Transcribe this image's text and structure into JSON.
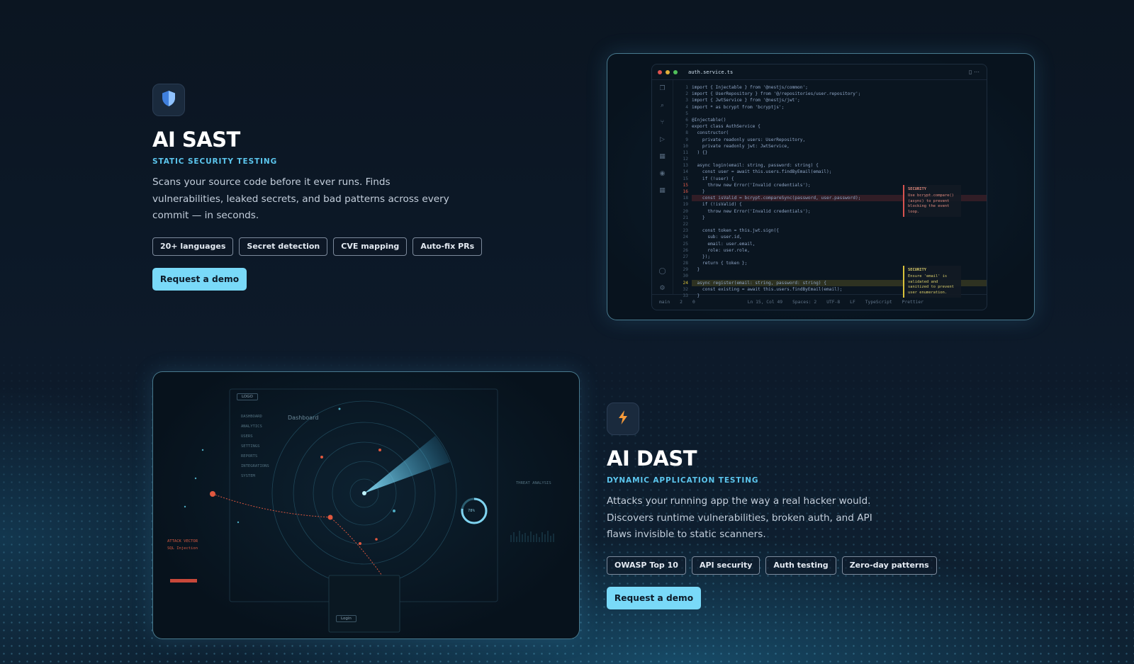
{
  "sast": {
    "icon": "shield-icon",
    "title": "AI SAST",
    "subtitle": "STATIC SECURITY TESTING",
    "description": "Scans your source code before it ever runs. Finds vulnerabilities, leaked secrets, and bad patterns across every commit — in seconds.",
    "tags": [
      "20+ languages",
      "Secret detection",
      "CVE mapping",
      "Auto-fix PRs"
    ],
    "cta": "Request a demo",
    "editor": {
      "filename": "auth.service.ts",
      "lines": [
        "import { Injectable } from '@nestjs/common';",
        "import { UserRepository } from '@/repositories/user.repository';",
        "import { JwtService } from '@nestjs/jwt';",
        "import * as bcrypt from 'bcryptjs';",
        "",
        "@Injectable()",
        "export class AuthService {",
        "  constructor(",
        "    private readonly users: UserRepository,",
        "    private readonly jwt: JwtService,",
        "  ) {}",
        "",
        "  async login(email: string, password: string) {",
        "    const user = await this.users.findByEmail(email);",
        "    if (!user) {",
        "      throw new Error('Invalid credentials');",
        "    }",
        "    const isValid = bcrypt.compareSync(password, user.password);",
        "    if (!isValid) {",
        "      throw new Error('Invalid credentials');",
        "    }",
        "",
        "    const token = this.jwt.sign({",
        "      sub: user.id,",
        "      email: user.email,",
        "      role: user.role,",
        "    });",
        "    return { token };",
        "  }",
        "",
        "  async register(email: string, password: string) {",
        "    const existing = await this.users.findByEmail(email);",
        "  }"
      ],
      "gutter_markers": {
        "16": "15",
        "17": "16",
        "31": "24"
      },
      "note_red": {
        "head": "SECURITY",
        "body": "Use bcrypt.compare() (async) to prevent blocking the event loop."
      },
      "note_yellow": {
        "head": "SECURITY",
        "body": "Ensure 'email' is validated and sanitized to prevent user enumeration."
      },
      "status": [
        "main",
        "2",
        "0",
        "Ln 15, Col 49",
        "Spaces: 2",
        "UTF-8",
        "LF",
        "TypeScript",
        "Prettier"
      ]
    }
  },
  "dast": {
    "icon": "bolt-icon",
    "title": "AI DAST",
    "subtitle": "DYNAMIC APPLICATION TESTING",
    "description": "Attacks your running app the way a real hacker would. Discovers runtime vulnerabilities, broken auth, and API flaws invisible to static scanners.",
    "tags": [
      "OWASP Top 10",
      "API security",
      "Auth testing",
      "Zero-day patterns"
    ],
    "cta": "Request a demo",
    "radar": {
      "logo": "LOGO",
      "dashboard": "Dashboard",
      "nav": [
        "DASHBOARD",
        "ANALYTICS",
        "USERS",
        "SETTINGS",
        "REPORTS",
        "INTEGRATIONS",
        "SYSTEM"
      ],
      "attack_vector": "ATTACK VECTOR",
      "sql_injection": "SQL Injection",
      "threat_analysis": "THREAT ANALYSIS",
      "gauge": "78%",
      "login": "Login",
      "percent_value": 0.78
    }
  },
  "colors": {
    "accent": "#5cc6ee",
    "button": "#79d9f8",
    "bolt": "#f59a3a",
    "shield": "#4a8fe6"
  }
}
